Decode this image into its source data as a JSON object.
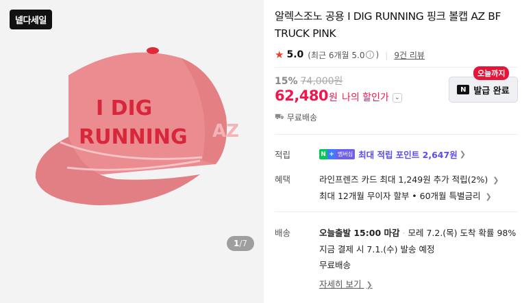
{
  "badge": "넽다세일",
  "pager": {
    "current": "1",
    "total": "/7"
  },
  "product": {
    "title": "알렉스조노 공용 I DIG RUNNING 핑크 볼캡 AZ BF TRUCK PINK"
  },
  "rating": {
    "star": "★",
    "score": "5.0",
    "recent_prefix": "(최근 6개월 5.0",
    "info_glyph": "i",
    "recent_suffix": ")",
    "reviews": "9건 리뷰"
  },
  "price": {
    "discount_rate": "15%",
    "original": "74,000원",
    "sale": "62,480",
    "currency": "원",
    "my_price_label": "나의 할인가"
  },
  "coupon": {
    "tag": "오늘까지",
    "label": "발급 완료",
    "logo": "N"
  },
  "shipping_summary": "무료배송",
  "points": {
    "label": "적립",
    "badge_n": "N",
    "badge_plus": "+",
    "badge_member": "멤버십",
    "text": "최대 적립 포인트 2,647원"
  },
  "benefits": {
    "label": "혜택",
    "line1": "라인프렌즈 카드 최대 1,249원 추가 적립(2%)",
    "line2": "최대 12개월 무이자 할부 • 60개월 특별금리"
  },
  "delivery": {
    "label": "배송",
    "today": "오늘출발 15:00 마감",
    "arrival": "모레 7.2.(목) 도착 확률 98%",
    "line2": "지금 결제 시 7.1.(수) 발송 예정",
    "line3": "무료배송",
    "detail_link": "자세히 보기"
  },
  "cap": {
    "text_line1": "I DIG",
    "text_line2": "RUNNING",
    "side_text": "AZ"
  },
  "colors": {
    "accent": "#f0174f",
    "points": "#5a4cf0",
    "cap_pink": "#e98a8e",
    "cap_text": "#d8263a"
  }
}
